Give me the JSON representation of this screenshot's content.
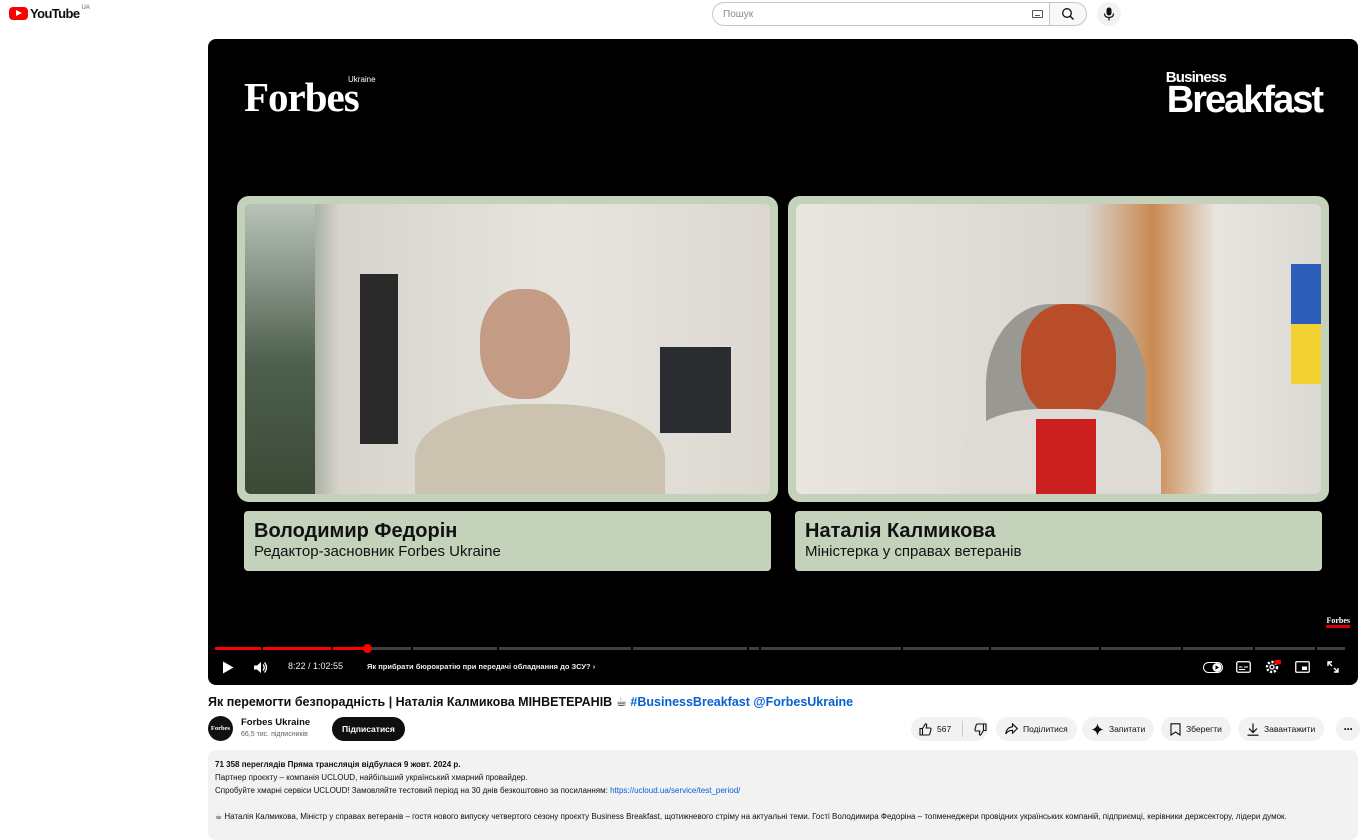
{
  "header": {
    "logo_text": "YouTube",
    "region": "UA",
    "search_placeholder": "Пошук"
  },
  "player": {
    "brand_left": "Forbes",
    "brand_left_sub": "Ukraine",
    "brand_right_small": "Business",
    "brand_right_big": "Breakfast",
    "corner_logo": "Forbes",
    "speakers": [
      {
        "name": "Володимир Федорін",
        "role": "Редактор-засновник Forbes Ukraine"
      },
      {
        "name": "Наталія Калмикова",
        "role": "Міністерка у справах ветеранів"
      }
    ],
    "time": "8:22 / 1:02:55",
    "chapter": "Як прибрати бюрократію при передачі обладнання до ЗСУ?",
    "progress_fraction": 0.133
  },
  "video": {
    "title": "Як перемогти безпорадність | Наталія Калмикова МІНВЕТЕРАНІВ",
    "title_emoji": "☕",
    "hashtag": "#BusinessBreakfast",
    "mention": "@ForbesUkraine"
  },
  "channel": {
    "avatar_text": "Forbes",
    "name": "Forbes Ukraine",
    "subscribers": "66,5 тис. підписників",
    "subscribe_label": "Підписатися"
  },
  "actions": {
    "likes": "567",
    "share": "Поділитися",
    "ask": "Запитати",
    "save": "Зберегти",
    "download": "Завантажити"
  },
  "description": {
    "stats": "71 358 переглядів  Пряма трансляція відбулася 9 жовт. 2024 р.",
    "line1": "Партнер проєкту – компанія UCLOUD, найбільший український хмарний провайдер.",
    "line2": "Спробуйте хмарні сервіси UCLOUD! Замовляйте тестовий період на 30 днів безкоштовно за посиланням: ",
    "link": "https://ucloud.ua/service/test_period/",
    "line3_emoji": "☕",
    "line3": " Наталія Калмикова, Міністр у справах ветеранів – гостя нового випуску четвертого сезону проєкту Business Breakfast, щотижневого стріму на актуальні теми. Гості Володимира Федоріна – топменеджери провідних українських компаній, підприємці, керівники держсектору, лідери думок."
  }
}
